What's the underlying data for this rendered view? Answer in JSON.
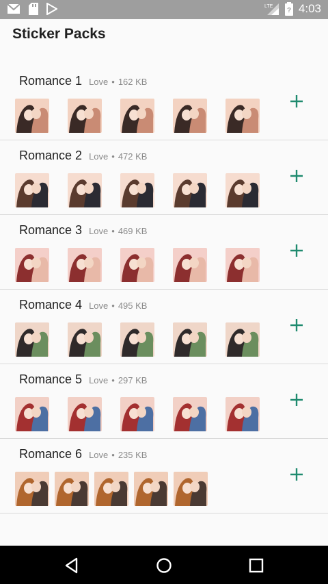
{
  "status_bar": {
    "time": "4:03",
    "network": "LTE",
    "icons": [
      "gmail-icon",
      "sd-card-icon",
      "play-store-icon",
      "signal-icon",
      "battery-icon"
    ]
  },
  "app_bar": {
    "title": "Sticker Packs"
  },
  "colors": {
    "accent": "#1e8a6e",
    "status_bar": "#9e9e9e"
  },
  "packs": [
    {
      "name": "Romance 1",
      "category": "Love",
      "size": "162 KB",
      "stickers": [
        "couple-kiss-sticker",
        "couple-kiss-sticker",
        "couple-hug-sticker",
        "couple-kiss-sticker",
        "couple-forehead-kiss-sticker"
      ]
    },
    {
      "name": "Romance 2",
      "category": "Love",
      "size": "472 KB",
      "stickers": [
        "couple-hug-sticker",
        "couple-hug-sticker",
        "couple-kiss-sticker",
        "couple-kiss-sticker",
        "couple-hug-sticker"
      ]
    },
    {
      "name": "Romance 3",
      "category": "Love",
      "size": "469 KB",
      "stickers": [
        "couple-hug-sticker",
        "couple-kiss-sticker",
        "couple-hug-sticker",
        "couple-kiss-sticker",
        "couple-kiss-sticker"
      ]
    },
    {
      "name": "Romance 4",
      "category": "Love",
      "size": "495 KB",
      "stickers": [
        "couple-hug-sticker",
        "couple-kiss-sticker",
        "couple-kiss-sticker",
        "couple-hug-sticker",
        "couple-standing-sticker"
      ]
    },
    {
      "name": "Romance 5",
      "category": "Love",
      "size": "297 KB",
      "stickers": [
        "couple-hug-sticker",
        "couple-hug-sticker",
        "couple-kiss-sticker",
        "couple-lying-sticker",
        "couple-hug-sticker"
      ]
    },
    {
      "name": "Romance 6",
      "category": "Love",
      "size": "235 KB",
      "stickers": [
        "couple-kiss-sticker",
        "couple-kiss-sticker",
        "couple-kiss-sticker",
        "couple-kiss-sticker",
        "couple-kiss-sticker"
      ]
    }
  ],
  "nav_bar": {
    "buttons": [
      "back-icon",
      "home-icon",
      "recents-icon"
    ]
  }
}
